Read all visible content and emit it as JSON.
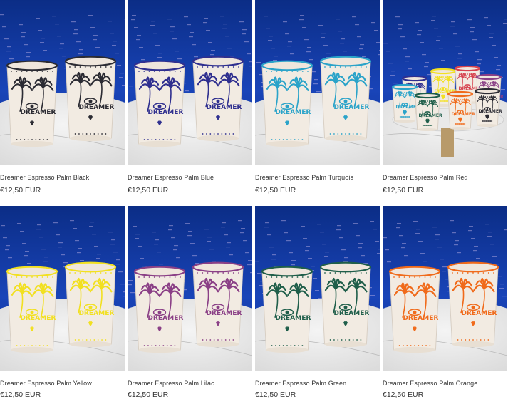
{
  "products": [
    {
      "name": "Dreamer Espresso Palm Black",
      "price": "€12,50 EUR",
      "accent": "#2b2b33",
      "variant": "pair"
    },
    {
      "name": "Dreamer Espresso Palm Blue",
      "price": "€12,50 EUR",
      "accent": "#2f2f8f",
      "variant": "pair"
    },
    {
      "name": "Dreamer Espresso Palm Turquois",
      "price": "€12,50 EUR",
      "accent": "#2aa3c9",
      "variant": "pair"
    },
    {
      "name": "Dreamer Espresso Palm Red",
      "price": "€12,50 EUR",
      "accent": "#d6434f",
      "variant": "group"
    },
    {
      "name": "Dreamer Espresso Palm Yellow",
      "price": "€12,50 EUR",
      "accent": "#f2e020",
      "variant": "pair"
    },
    {
      "name": "Dreamer Espresso Palm Lilac",
      "price": "€12,50 EUR",
      "accent": "#8a3f86",
      "variant": "pair"
    },
    {
      "name": "Dreamer Espresso Palm Green",
      "price": "€12,50 EUR",
      "accent": "#1f5e4a",
      "variant": "pair"
    },
    {
      "name": "Dreamer Espresso Palm Orange",
      "price": "€12,50 EUR",
      "accent": "#f06a1a",
      "variant": "pair"
    }
  ],
  "cup_text": "DREAMER"
}
